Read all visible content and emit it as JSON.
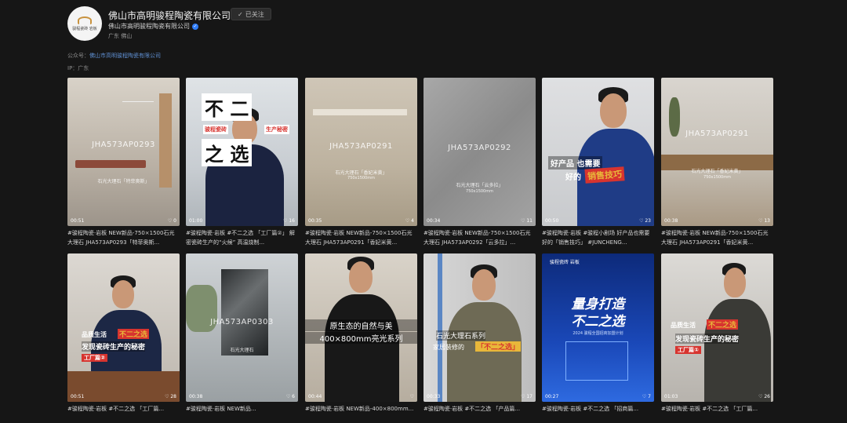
{
  "profile": {
    "title": "佛山市高明骏程陶瓷有限公司",
    "follow_label": "已关注",
    "follow_icon": "check-icon",
    "subtitle": "佛山市高明骏程陶瓷有限公司",
    "location": "广东 佛山",
    "avatar_text": "骏程瓷砖 岩板"
  },
  "info": {
    "account_label": "公众号：",
    "account_value": "佛山市高明骏程陶瓷有限公司",
    "ip_label": "IP：",
    "ip_value": "广东"
  },
  "videos": [
    {
      "caption": "#骏程陶瓷·岩板 NEW新品-750×1500石光大理石 JHA573AP0293「特菲奥斯...",
      "duration": "00:51",
      "likes": "0",
      "overlay": "JHA573AP0293",
      "overlay2": "石光大理石「特菲奥斯」"
    },
    {
      "caption": "#骏程陶瓷·岩板 #不二之选 「工厂篇②」 解密瓷砖生产的“火候” 高温烧制...",
      "duration": "01:00",
      "likes": "16",
      "overlay": "不 二",
      "overlay2": "之 选",
      "tag1": "骏程瓷砖",
      "tag2": "生产秘密"
    },
    {
      "caption": "#骏程陶瓷·岩板 NEW新品-750×1500石光大理石 JHA573AP0291「香妃米黄...",
      "duration": "00:35",
      "likes": "4",
      "overlay": "JHA573AP0291",
      "overlay2": "石光大理石「香妃米黄」",
      "overlay3": "750x1500mm"
    },
    {
      "caption": "#骏程陶瓷·岩板 NEW新品-750×1500石光大理石 JHA573AP0292「云多拉」...",
      "duration": "00:34",
      "likes": "11",
      "overlay": "JHA573AP0292",
      "overlay2": "石光大理石「云多拉」",
      "overlay3": "750x1500mm"
    },
    {
      "caption": "#骏程陶瓷·岩板 #骏程小剧场 好产品也需要好的「销售技巧」 #JUNCHENG...",
      "duration": "00:50",
      "likes": "23",
      "overlay": "好产品 也需要",
      "overlay2": "好的",
      "overlay3": "销售技巧"
    },
    {
      "caption": "#骏程陶瓷·岩板 NEW新品-750×1500石光大理石 JHA573AP0291「香妃米黄...",
      "duration": "00:38",
      "likes": "13",
      "overlay": "JHA573AP0291",
      "overlay2": "石光大理石「香妃米黄」",
      "overlay3": "750x1500mm"
    },
    {
      "caption": "#骏程陶瓷·岩板 #不二之选 「工厂篇...",
      "duration": "00:51",
      "likes": "28",
      "overlay": "品质生活",
      "overlay2": "不二之选",
      "overlay3": "发现瓷砖生产的秘密",
      "overlay4": "工厂篇②"
    },
    {
      "caption": "#骏程陶瓷·岩板 NEW新品...",
      "duration": "00:38",
      "likes": "6",
      "overlay": "JHA573AP0303",
      "overlay2": "石光大理石"
    },
    {
      "caption": "#骏程陶瓷·岩板 NEW新品-400×800mm...",
      "duration": "00:44",
      "likes": "",
      "overlay": "原生态的自然与美",
      "overlay2": "400×800mm亮光系列"
    },
    {
      "caption": "#骏程陶瓷·岩板 #不二之选 「产品篇...",
      "duration": "00:33",
      "likes": "17",
      "overlay": "石光大理石系列",
      "overlay2": "家居装修的",
      "overlay3": "「不二之选」"
    },
    {
      "caption": "#骏程陶瓷·岩板 #不二之选 「招商篇...",
      "duration": "00:27",
      "likes": "7",
      "overlay": "量身打造",
      "overlay2": "不二之选",
      "overlay3": "2024 骏程全国招商加盟计划",
      "overlay4": "骏程瓷砖 岩板"
    },
    {
      "caption": "#骏程陶瓷·岩板 #不二之选 「工厂篇...",
      "duration": "01:03",
      "likes": "26",
      "overlay": "品质生活",
      "overlay2": "不二之选",
      "overlay3": "发现瓷砖生产的秘密",
      "overlay4": "工厂篇①"
    }
  ],
  "colors": {
    "background": "#161616",
    "accent_gold": "#e8b73a",
    "accent_red": "#d7342f",
    "link": "#5f8fd1"
  }
}
